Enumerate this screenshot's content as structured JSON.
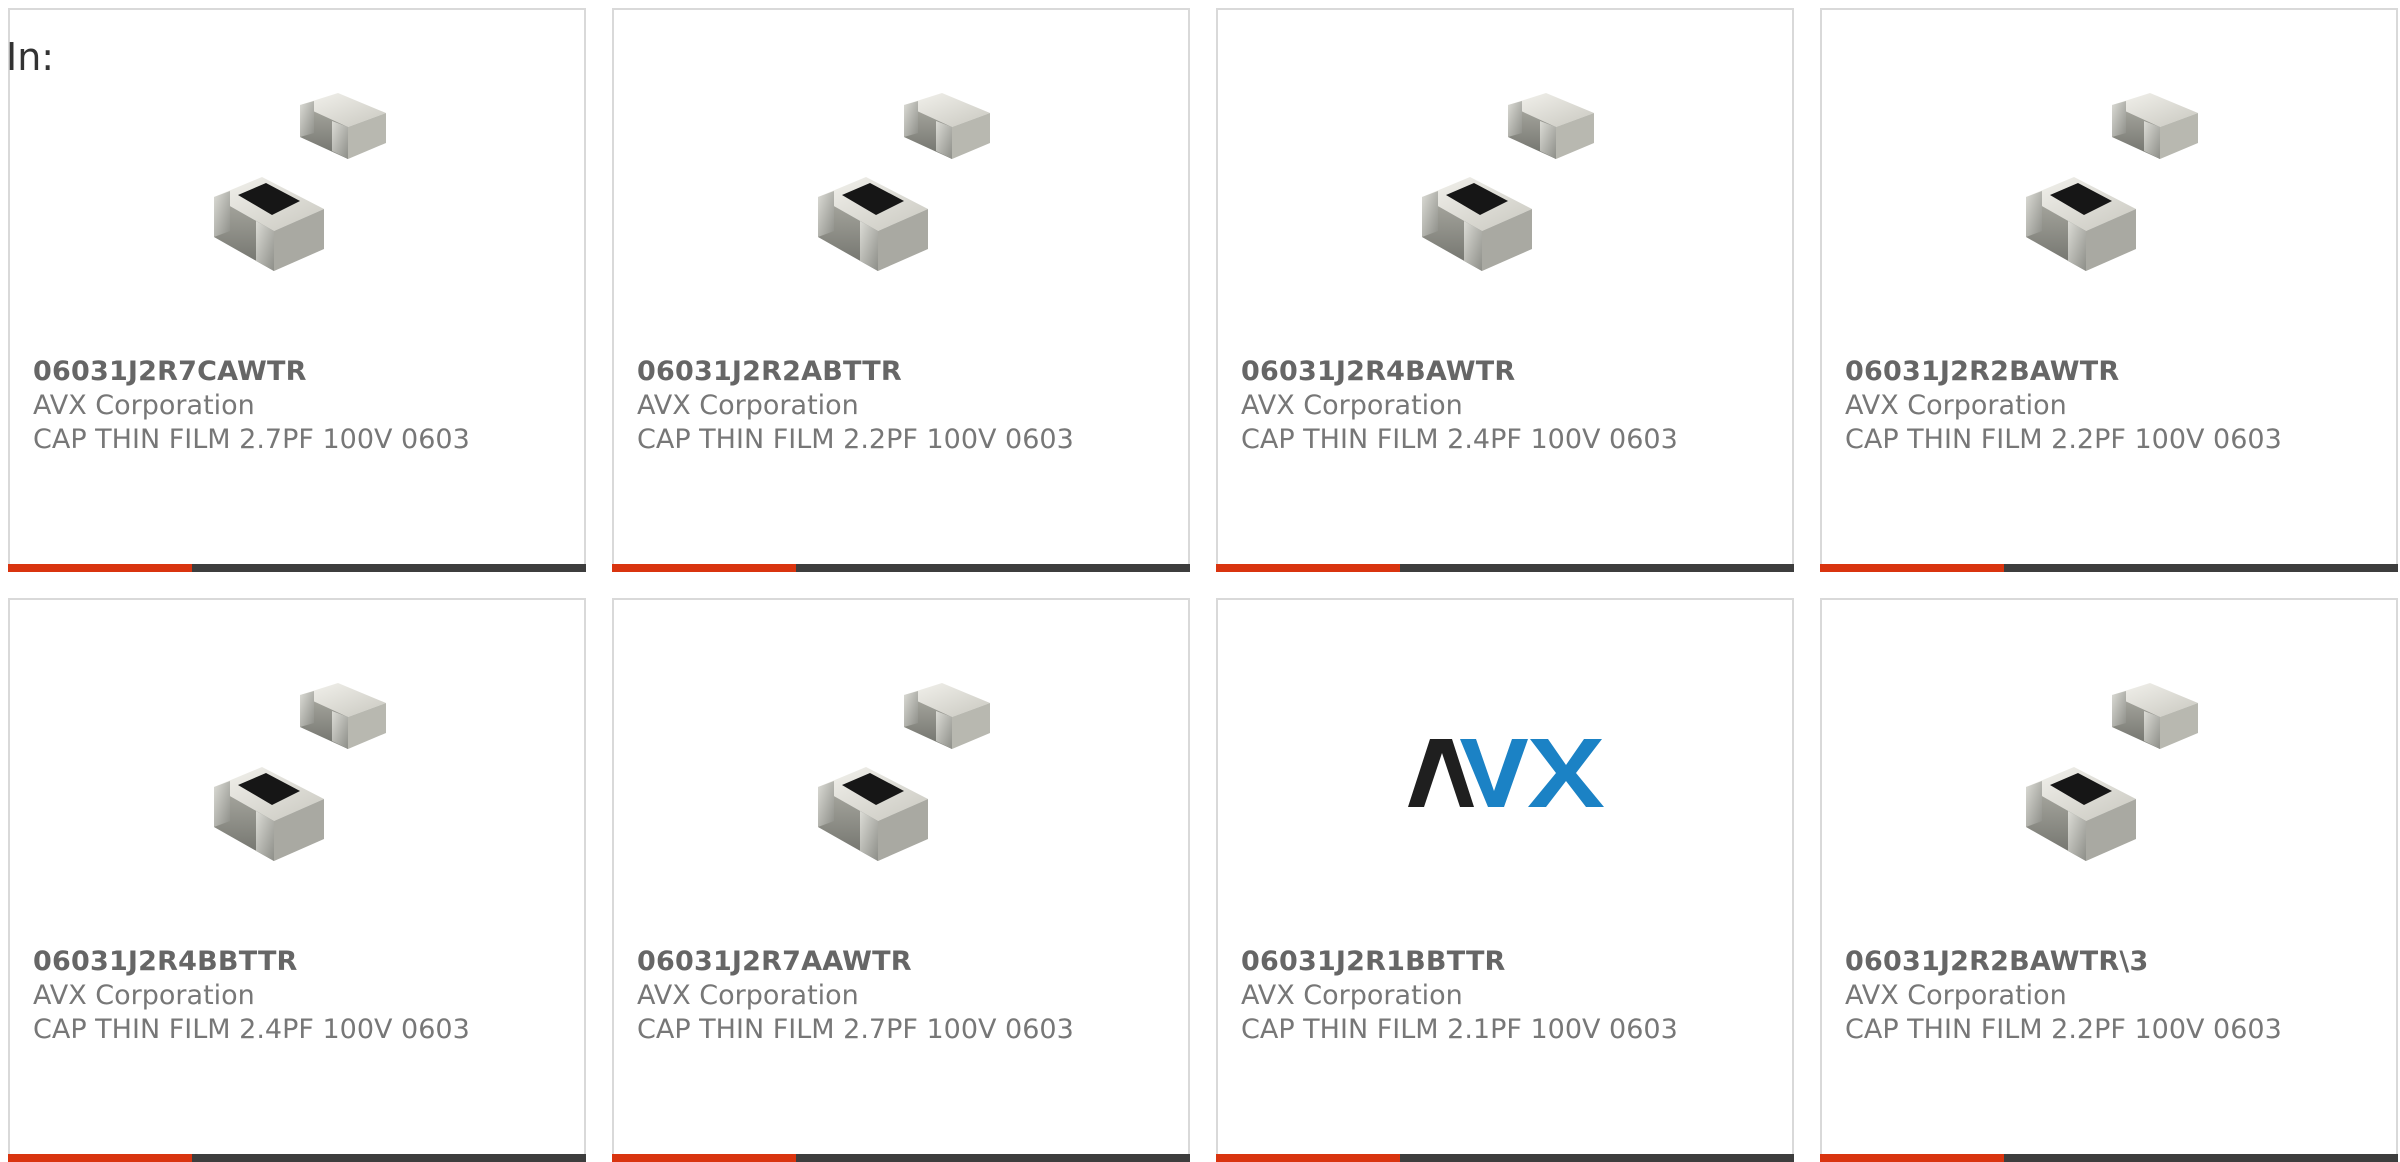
{
  "page": {
    "heading": "In:"
  },
  "colors": {
    "accent": "#d9340f",
    "bar": "#3d3d3d",
    "border": "#d9d9d9",
    "avx_dark": "#1f1f1f",
    "avx_blue": "#1b82c5"
  },
  "products": [
    {
      "part": "06031J2R7CAWTR",
      "manufacturer": "AVX Corporation",
      "description": "CAP THIN FILM 2.7PF 100V 0603",
      "image": "capacitor-chip-image"
    },
    {
      "part": "06031J2R2ABTTR",
      "manufacturer": "AVX Corporation",
      "description": "CAP THIN FILM 2.2PF 100V 0603",
      "image": "capacitor-chip-image"
    },
    {
      "part": "06031J2R4BAWTR",
      "manufacturer": "AVX Corporation",
      "description": "CAP THIN FILM 2.4PF 100V 0603",
      "image": "capacitor-chip-image"
    },
    {
      "part": "06031J2R2BAWTR",
      "manufacturer": "AVX Corporation",
      "description": "CAP THIN FILM 2.2PF 100V 0603",
      "image": "capacitor-chip-image"
    },
    {
      "part": "06031J2R4BBTTR",
      "manufacturer": "AVX Corporation",
      "description": "CAP THIN FILM 2.4PF 100V 0603",
      "image": "capacitor-chip-image"
    },
    {
      "part": "06031J2R7AAWTR",
      "manufacturer": "AVX Corporation",
      "description": "CAP THIN FILM 2.7PF 100V 0603",
      "image": "capacitor-chip-image"
    },
    {
      "part": "06031J2R1BBTTR",
      "manufacturer": "AVX Corporation",
      "description": "CAP THIN FILM 2.1PF 100V 0603",
      "image": "avx-logo",
      "logo_text": "AVX"
    },
    {
      "part": "06031J2R2BAWTR\\3",
      "manufacturer": "AVX Corporation",
      "description": "CAP THIN FILM 2.2PF 100V 0603",
      "image": "capacitor-chip-image"
    }
  ]
}
